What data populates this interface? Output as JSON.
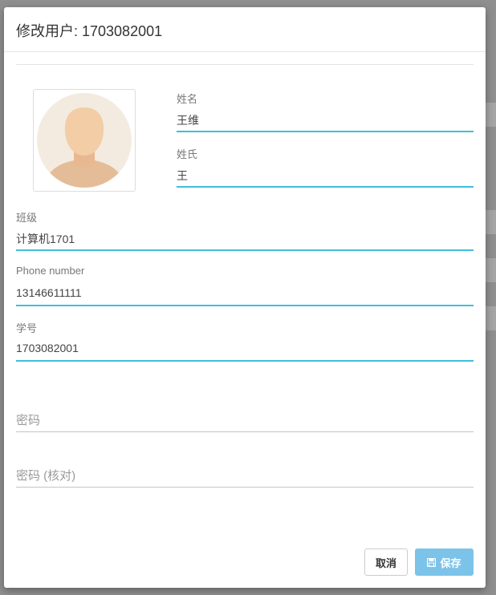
{
  "dialog": {
    "title": "修改用户: 1703082001"
  },
  "avatar": {
    "icon": "user-silhouette-icon"
  },
  "fields": {
    "given_name": {
      "label": "姓名",
      "value": "王维"
    },
    "surname": {
      "label": "姓氏",
      "value": "王"
    },
    "class": {
      "label": "班级",
      "value": "计算机1701"
    },
    "phone": {
      "label": "Phone number",
      "value": "13146611111"
    },
    "student_id": {
      "label": "学号",
      "value": "1703082001"
    }
  },
  "password": {
    "placeholder": "密码",
    "confirm_placeholder": "密码 (核对)"
  },
  "buttons": {
    "cancel_label": "取消",
    "save_label": "保存",
    "save_icon": "floppy-disk-icon"
  },
  "colors": {
    "accent_line": "#3fbfdc",
    "save_button": "#7cc3ea"
  }
}
